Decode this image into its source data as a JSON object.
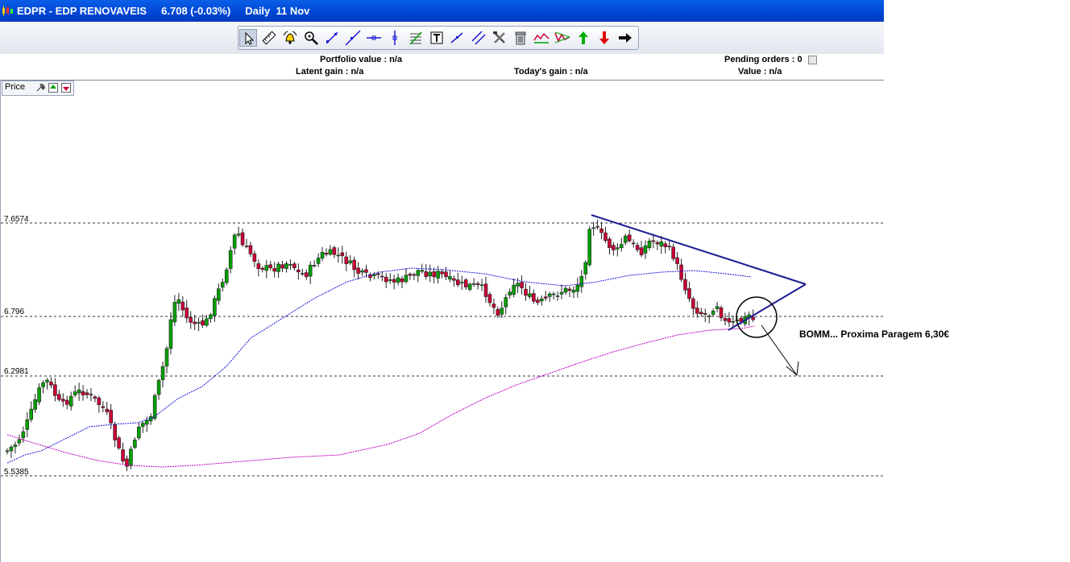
{
  "window": {
    "title": "EDPR - EDP RENOVAVEIS     6.708 (-0.03%)     Daily  11 Nov",
    "app_icon": "candlestick-icon"
  },
  "toolbar": {
    "buttons": [
      {
        "name": "pointer-tool",
        "icon": "cursor-arrow-icon",
        "active": true
      },
      {
        "name": "ruler-tool",
        "icon": "ruler-icon"
      },
      {
        "name": "alert-tool",
        "icon": "bell-icon"
      },
      {
        "name": "zoom-tool",
        "icon": "magnifier-icon"
      },
      {
        "name": "trendline-tool",
        "icon": "trendline-icon"
      },
      {
        "name": "line-tool",
        "icon": "diagonal-line-icon"
      },
      {
        "name": "horizontal-line-tool",
        "icon": "horizontal-line-icon"
      },
      {
        "name": "vertical-line-tool",
        "icon": "vertical-line-icon"
      },
      {
        "name": "fibonacci-tool",
        "icon": "fibonacci-icon"
      },
      {
        "name": "text-tool",
        "icon": "text-icon"
      },
      {
        "name": "channel-tool",
        "icon": "channel-icon"
      },
      {
        "name": "parallel-tool",
        "icon": "parallel-lines-icon"
      },
      {
        "name": "tools-tool",
        "icon": "hammer-wrench-icon"
      },
      {
        "name": "delete-tool",
        "icon": "trash-icon"
      },
      {
        "name": "pattern-tool",
        "icon": "pattern-icon"
      },
      {
        "name": "triangle-tool",
        "icon": "triangle-pattern-icon"
      },
      {
        "name": "buy-signal",
        "icon": "arrow-up-green-icon"
      },
      {
        "name": "sell-signal",
        "icon": "arrow-down-red-icon"
      },
      {
        "name": "next-signal",
        "icon": "arrow-right-icon"
      }
    ]
  },
  "info": {
    "portfolio_value": "Portfolio value : n/a",
    "latent_gain": "Latent gain : n/a",
    "todays_gain": "Today's gain : n/a",
    "pending_orders": "Pending orders : 0",
    "value": "Value : n/a"
  },
  "panel": {
    "label": "Price"
  },
  "chart_data": {
    "type": "candlestick",
    "levels": [
      "7.6574",
      "6.796",
      "6.2981",
      "5.5385"
    ],
    "annotation": "BOMM... Proxima Paragem 6,30€",
    "colors": {
      "up": "#00a000",
      "down": "#cc0033",
      "ma_short": "#1a1ad6",
      "ma_long": "#c000c0",
      "trend": "#1c1c96"
    },
    "x_labels_shown": false,
    "grid": "dashed horizontal at levels"
  }
}
